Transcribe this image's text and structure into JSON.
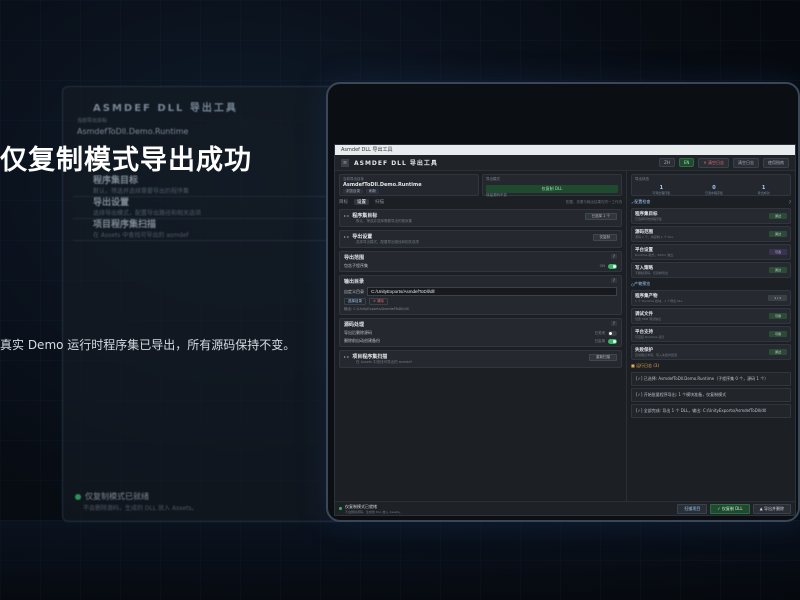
{
  "slide": {
    "headline": "仅复制模式导出成功",
    "subline": "真实 Demo 运行时程序集已导出，所有源码保持不变。"
  },
  "back_window": {
    "title": "ASMDEF DLL 导出工具",
    "current_label": "当前导出目标",
    "current_value": "AsmdefToDll.Demo.Runtime",
    "cards": [
      {
        "title": "程序集目标",
        "desc": "默认，筛选并选择需要导出的程序集"
      },
      {
        "title": "导出设置",
        "desc": "选择导出模式，配置导出路径和相关选项"
      },
      {
        "title": "项目程序集扫描",
        "desc": "在 Assets 中查找可导出的 asmdef"
      }
    ],
    "footer_title": "仅复制模式已就绪",
    "footer_sub": "不会删除源码，生成的 DLL 放入 Assets。"
  },
  "app": {
    "window_title": "Asmdef DLL 导出工具",
    "header_title": "ASMDEF DLL 导出工具",
    "lang": "EN",
    "lang_alt": "ZH",
    "clear_log": "清空日志",
    "clear_log2": "清空日志",
    "help": "使用指南",
    "target_label": "当前导出目标",
    "target_value": "AsmdefToDll.Demo.Runtime",
    "target_btn": "浏览目录",
    "target_btn2": "刷新",
    "mode_label": "导出模式",
    "mode_value": "仅复制 DLL",
    "mode_desc": "保留源码不变",
    "status_label": "导出状态",
    "stats": [
      {
        "n": "1",
        "l": "可导出程序集"
      },
      {
        "n": "0",
        "l": "已选中程序集"
      },
      {
        "n": "1",
        "l": "导出成功"
      }
    ],
    "tabs": [
      "目标",
      "设置",
      "扫描"
    ],
    "tabs_hint": "配置、查看与输出结果在同一工作流",
    "sections": {
      "assembly": {
        "title": "程序集目标",
        "desc": "默认，筛选并选择需要导出的程序集",
        "btn": "已选择 1 个"
      },
      "settings": {
        "title": "导出设置",
        "desc": "选择导出模式，配置导出路径和相关选项",
        "btn": "仅复制"
      },
      "strategy": {
        "title": "导出范围",
        "row": "包含子程序集",
        "on": "ON"
      },
      "output": {
        "title": "输出目录",
        "label": "自定义目录",
        "path": "C:/UnityExports/AsmdefToDll/dll",
        "select": "选择目录",
        "clear": "清除",
        "hint": "输出: C:/UnityExports/AsmdefToDll/dll"
      },
      "source": {
        "title": "源码处理",
        "row": "导出后删除源码",
        "off": "已关闭",
        "row2": "删除前自动创建备份",
        "on2": "已启用"
      },
      "scan": {
        "title": "项目程序集扫描",
        "desc": "在 Assets 中查找可导出的 asmdef",
        "btn": "重新扫描"
      }
    },
    "right": {
      "header": "配置检查",
      "checks": [
        {
          "t": "程序集目标",
          "d": "已选择有效的程序集",
          "btn": "通过"
        },
        {
          "t": "源码范围",
          "d": "源码 1 个，将复制 1 个 DLL",
          "btn": "通过"
        },
        {
          "t": "平台设置",
          "d": "Runtime 模式，Editor 独立",
          "btn": "可选"
        },
        {
          "t": "写入策略",
          "d": "不删除源码，仅复制导出",
          "btn": "通过"
        }
      ],
      "build_header": "产物预览",
      "builds": [
        {
          "t": "程序集产物",
          "d": "1 个 Runtime 模块，1 个导出 DLL",
          "btn": "1 / 1"
        },
        {
          "t": "调试文件",
          "d": "包含 PDB 调试信息",
          "btn": "可用"
        },
        {
          "t": "平台支持",
          "d": "可直接 Runtime 运行",
          "btn": "可用"
        },
        {
          "t": "失败保护",
          "d": "自动跳过冲突，写入失败时回退",
          "btn": "通过"
        }
      ],
      "log_title": "运行日志 (3)",
      "logs": [
        "[✓] 已选择: AsmdefToDll.Demo.Runtime（子程序集 0 个，源码 1 个）",
        "[✓] 开始批量程序导出: 1 个模块准备，仅复制模式",
        "[✓] 全部完成: 导出 1 个 DLL，输出: C:/UnityExports/AsmdefToDll/dll"
      ]
    },
    "footer": {
      "title": "仅复制模式已就绪",
      "sub": "不会删除源码，生成的 DLL 放入 Assets。",
      "scan": "扫描项目",
      "copy": "仅复制 DLL",
      "export": "导出并删除"
    }
  }
}
